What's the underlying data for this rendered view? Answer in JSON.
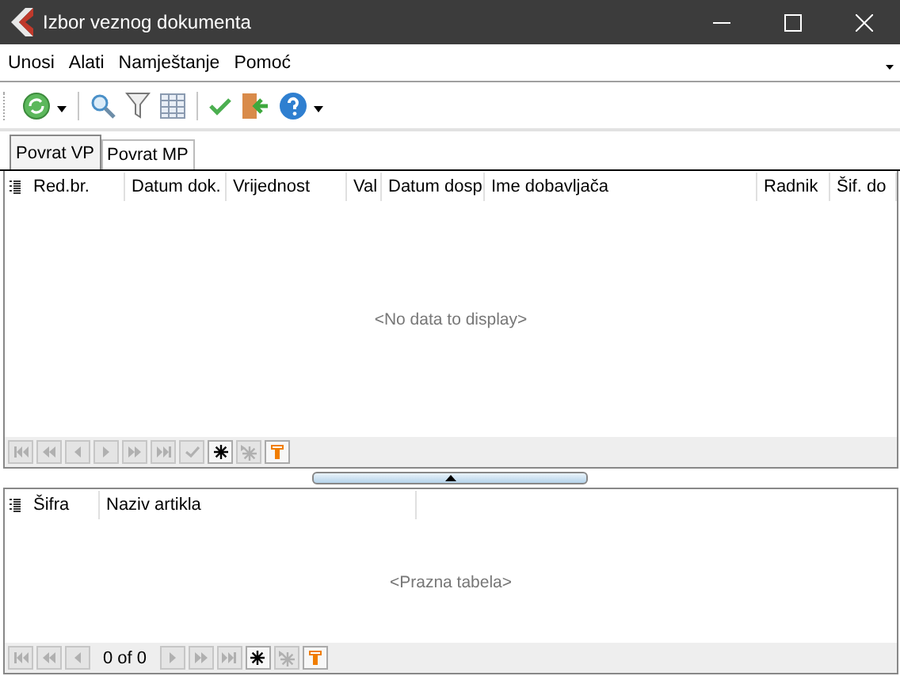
{
  "window": {
    "title": "Izbor veznog dokumenta"
  },
  "menu": [
    {
      "label": "Unosi"
    },
    {
      "label": "Alati"
    },
    {
      "label": "Namještanje"
    },
    {
      "label": "Pomoć"
    }
  ],
  "toolbar": [
    {
      "kind": "refresh"
    },
    {
      "kind": "dropdown"
    },
    {
      "kind": "separator"
    },
    {
      "kind": "search"
    },
    {
      "kind": "filter"
    },
    {
      "kind": "table"
    },
    {
      "kind": "separator"
    },
    {
      "kind": "check"
    },
    {
      "kind": "exit"
    },
    {
      "kind": "help"
    },
    {
      "kind": "dropdown"
    }
  ],
  "tabs": [
    {
      "label": "Povrat VP",
      "selected": true
    },
    {
      "label": "Povrat MP",
      "selected": false
    }
  ],
  "upper_grid": {
    "columns": [
      "Red.br.",
      "Datum dok.",
      "Vrijednost",
      "Val",
      "Datum dosp",
      "Ime dobavljača",
      "Radnik",
      "Šif. do"
    ],
    "empty_text": "<No data to display>",
    "navigator": [
      {
        "kind": "first",
        "disabled": true
      },
      {
        "kind": "prev-page",
        "disabled": true
      },
      {
        "kind": "prev",
        "disabled": true
      },
      {
        "kind": "next",
        "disabled": true
      },
      {
        "kind": "next-page",
        "disabled": true
      },
      {
        "kind": "last",
        "disabled": true
      },
      {
        "kind": "post",
        "disabled": true
      },
      {
        "kind": "insert",
        "disabled": false
      },
      {
        "kind": "cancel",
        "disabled": true
      },
      {
        "kind": "filter",
        "disabled": false
      }
    ]
  },
  "lower_grid": {
    "columns": [
      "Šifra",
      "Naziv artikla"
    ],
    "empty_text": "<Prazna tabela>",
    "navigator": [
      {
        "kind": "first",
        "disabled": true
      },
      {
        "kind": "prev-page",
        "disabled": true
      },
      {
        "kind": "prev",
        "disabled": true
      },
      {
        "kind": "record",
        "text": "0 of 0"
      },
      {
        "kind": "next",
        "disabled": true
      },
      {
        "kind": "next-page",
        "disabled": true
      },
      {
        "kind": "last",
        "disabled": true
      },
      {
        "kind": "insert",
        "disabled": false
      },
      {
        "kind": "cancel",
        "disabled": true
      },
      {
        "kind": "filter",
        "disabled": false
      }
    ]
  }
}
